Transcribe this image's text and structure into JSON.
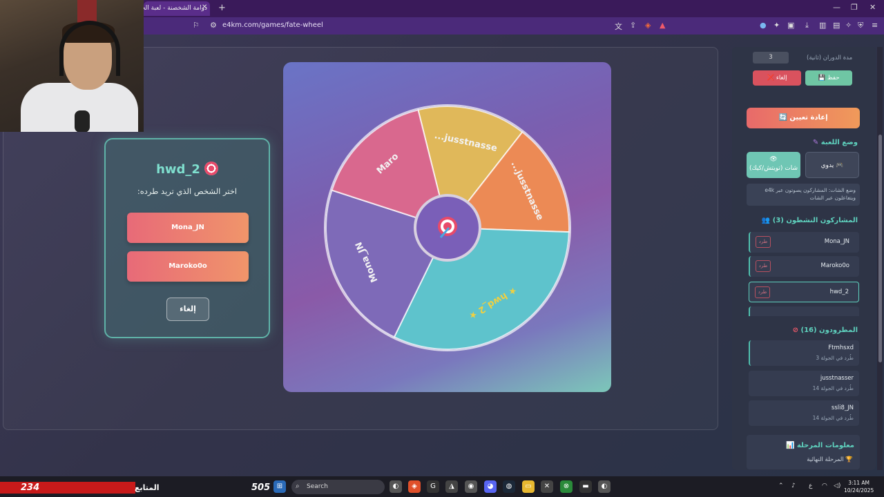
{
  "browser": {
    "tab_title": "دوامة الشخصنة - لعبة الحظ",
    "url": "e4km.com/games/fate-wheel"
  },
  "modal": {
    "title": "hwd_2",
    "subtitle": "اختر الشخص الذي تريد طرده:",
    "options": [
      "Mona_JN",
      "Maroko0o"
    ],
    "cancel": "إلغاء"
  },
  "wheel": {
    "segments": [
      {
        "label": "...jusstnasse",
        "color": "#e0b85a"
      },
      {
        "label": "...jusstnasse",
        "color": "#ec8a55"
      },
      {
        "label": "hwd_2",
        "color": "#5ec3cc",
        "starred": true
      },
      {
        "label": "Mona_JN",
        "color": "#7e6ab8"
      },
      {
        "label": "Maro",
        "color": "#d9688e"
      }
    ]
  },
  "sidebar": {
    "spin_duration_label": "مدة الدوران (ثانية)",
    "spin_duration_value": "3",
    "save_label": "💾 حفظ",
    "cancel_label": "❌ إلغاء",
    "reset_label": "🔄 إعادة تعيين",
    "mode_title": "وضع اللعبة",
    "mode_manual": "يدوي",
    "mode_chat": "شات (تويتش/كيك)",
    "mode_info": "وضع الشات: المشاركون يصوتون عبر e4k ويتفاعلون عبر الشات",
    "active_title": "المشاركون النشطون (3)",
    "active_players": [
      {
        "name": "Mona_JN",
        "kick": "طرد"
      },
      {
        "name": "Maroko0o",
        "kick": "طرد"
      },
      {
        "name": "hwd_2",
        "kick": "طرد"
      }
    ],
    "eliminated_title": "المطرودون (16)",
    "eliminated": [
      {
        "name": "Ftmhsxd",
        "round": "طُرد في الجولة 3"
      },
      {
        "name": "jusstnasser",
        "round": "طُرد في الجولة 14"
      },
      {
        "name": "ssli8_JN",
        "round": "طُرد في الجولة 14"
      }
    ],
    "stage_title": "معلومات المرحلة",
    "stage_value": "المرحلة النهائية"
  },
  "stream": {
    "follower_count": "234",
    "follower_label": "المتابع",
    "viewer_count": "505"
  },
  "taskbar": {
    "search_placeholder": "Search",
    "time": "3:11 AM",
    "date": "10/24/2025",
    "lang": "ع"
  }
}
